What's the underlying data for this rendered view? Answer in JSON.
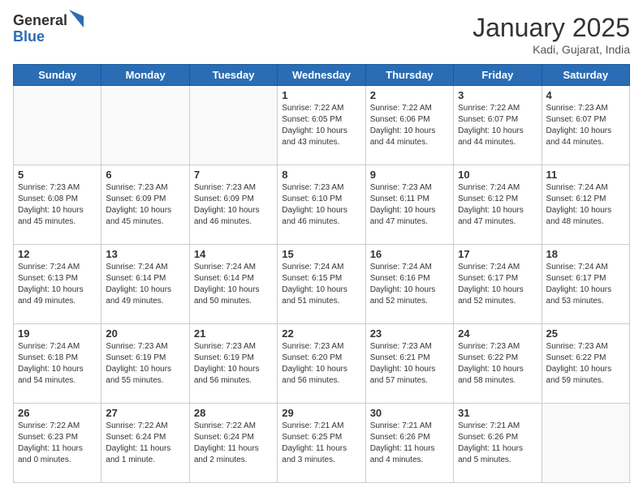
{
  "header": {
    "logo_general": "General",
    "logo_blue": "Blue",
    "month_year": "January 2025",
    "location": "Kadi, Gujarat, India"
  },
  "days_of_week": [
    "Sunday",
    "Monday",
    "Tuesday",
    "Wednesday",
    "Thursday",
    "Friday",
    "Saturday"
  ],
  "weeks": [
    [
      {
        "day": "",
        "info": ""
      },
      {
        "day": "",
        "info": ""
      },
      {
        "day": "",
        "info": ""
      },
      {
        "day": "1",
        "info": "Sunrise: 7:22 AM\nSunset: 6:05 PM\nDaylight: 10 hours\nand 43 minutes."
      },
      {
        "day": "2",
        "info": "Sunrise: 7:22 AM\nSunset: 6:06 PM\nDaylight: 10 hours\nand 44 minutes."
      },
      {
        "day": "3",
        "info": "Sunrise: 7:22 AM\nSunset: 6:07 PM\nDaylight: 10 hours\nand 44 minutes."
      },
      {
        "day": "4",
        "info": "Sunrise: 7:23 AM\nSunset: 6:07 PM\nDaylight: 10 hours\nand 44 minutes."
      }
    ],
    [
      {
        "day": "5",
        "info": "Sunrise: 7:23 AM\nSunset: 6:08 PM\nDaylight: 10 hours\nand 45 minutes."
      },
      {
        "day": "6",
        "info": "Sunrise: 7:23 AM\nSunset: 6:09 PM\nDaylight: 10 hours\nand 45 minutes."
      },
      {
        "day": "7",
        "info": "Sunrise: 7:23 AM\nSunset: 6:09 PM\nDaylight: 10 hours\nand 46 minutes."
      },
      {
        "day": "8",
        "info": "Sunrise: 7:23 AM\nSunset: 6:10 PM\nDaylight: 10 hours\nand 46 minutes."
      },
      {
        "day": "9",
        "info": "Sunrise: 7:23 AM\nSunset: 6:11 PM\nDaylight: 10 hours\nand 47 minutes."
      },
      {
        "day": "10",
        "info": "Sunrise: 7:24 AM\nSunset: 6:12 PM\nDaylight: 10 hours\nand 47 minutes."
      },
      {
        "day": "11",
        "info": "Sunrise: 7:24 AM\nSunset: 6:12 PM\nDaylight: 10 hours\nand 48 minutes."
      }
    ],
    [
      {
        "day": "12",
        "info": "Sunrise: 7:24 AM\nSunset: 6:13 PM\nDaylight: 10 hours\nand 49 minutes."
      },
      {
        "day": "13",
        "info": "Sunrise: 7:24 AM\nSunset: 6:14 PM\nDaylight: 10 hours\nand 49 minutes."
      },
      {
        "day": "14",
        "info": "Sunrise: 7:24 AM\nSunset: 6:14 PM\nDaylight: 10 hours\nand 50 minutes."
      },
      {
        "day": "15",
        "info": "Sunrise: 7:24 AM\nSunset: 6:15 PM\nDaylight: 10 hours\nand 51 minutes."
      },
      {
        "day": "16",
        "info": "Sunrise: 7:24 AM\nSunset: 6:16 PM\nDaylight: 10 hours\nand 52 minutes."
      },
      {
        "day": "17",
        "info": "Sunrise: 7:24 AM\nSunset: 6:17 PM\nDaylight: 10 hours\nand 52 minutes."
      },
      {
        "day": "18",
        "info": "Sunrise: 7:24 AM\nSunset: 6:17 PM\nDaylight: 10 hours\nand 53 minutes."
      }
    ],
    [
      {
        "day": "19",
        "info": "Sunrise: 7:24 AM\nSunset: 6:18 PM\nDaylight: 10 hours\nand 54 minutes."
      },
      {
        "day": "20",
        "info": "Sunrise: 7:23 AM\nSunset: 6:19 PM\nDaylight: 10 hours\nand 55 minutes."
      },
      {
        "day": "21",
        "info": "Sunrise: 7:23 AM\nSunset: 6:19 PM\nDaylight: 10 hours\nand 56 minutes."
      },
      {
        "day": "22",
        "info": "Sunrise: 7:23 AM\nSunset: 6:20 PM\nDaylight: 10 hours\nand 56 minutes."
      },
      {
        "day": "23",
        "info": "Sunrise: 7:23 AM\nSunset: 6:21 PM\nDaylight: 10 hours\nand 57 minutes."
      },
      {
        "day": "24",
        "info": "Sunrise: 7:23 AM\nSunset: 6:22 PM\nDaylight: 10 hours\nand 58 minutes."
      },
      {
        "day": "25",
        "info": "Sunrise: 7:23 AM\nSunset: 6:22 PM\nDaylight: 10 hours\nand 59 minutes."
      }
    ],
    [
      {
        "day": "26",
        "info": "Sunrise: 7:22 AM\nSunset: 6:23 PM\nDaylight: 11 hours\nand 0 minutes."
      },
      {
        "day": "27",
        "info": "Sunrise: 7:22 AM\nSunset: 6:24 PM\nDaylight: 11 hours\nand 1 minute."
      },
      {
        "day": "28",
        "info": "Sunrise: 7:22 AM\nSunset: 6:24 PM\nDaylight: 11 hours\nand 2 minutes."
      },
      {
        "day": "29",
        "info": "Sunrise: 7:21 AM\nSunset: 6:25 PM\nDaylight: 11 hours\nand 3 minutes."
      },
      {
        "day": "30",
        "info": "Sunrise: 7:21 AM\nSunset: 6:26 PM\nDaylight: 11 hours\nand 4 minutes."
      },
      {
        "day": "31",
        "info": "Sunrise: 7:21 AM\nSunset: 6:26 PM\nDaylight: 11 hours\nand 5 minutes."
      },
      {
        "day": "",
        "info": ""
      }
    ]
  ]
}
